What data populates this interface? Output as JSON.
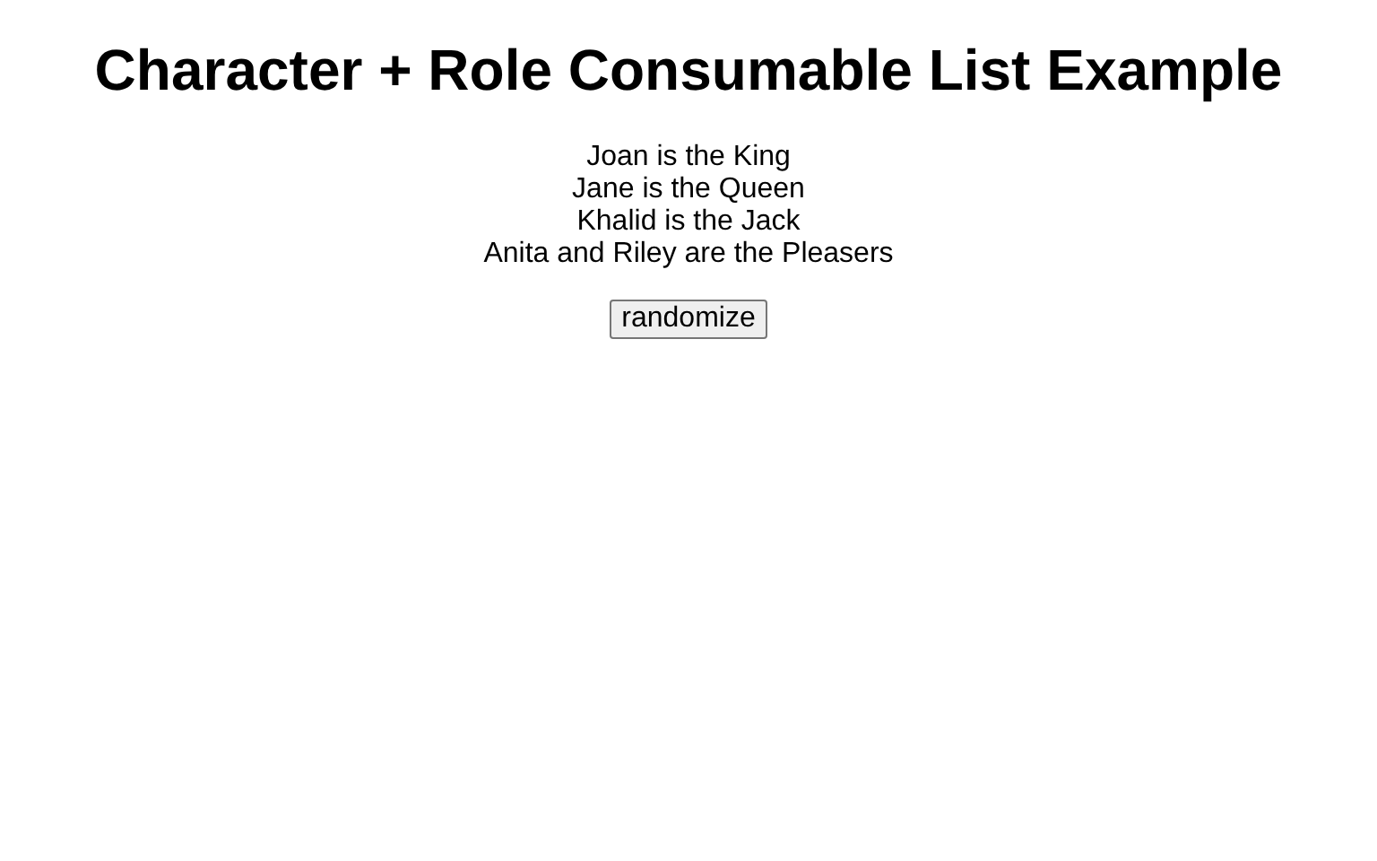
{
  "title": "Character + Role Consumable List Example",
  "assignments": [
    "Joan is the King",
    "Jane is the Queen",
    "Khalid is the Jack",
    "Anita and Riley are the Pleasers"
  ],
  "button": {
    "label": "randomize"
  }
}
